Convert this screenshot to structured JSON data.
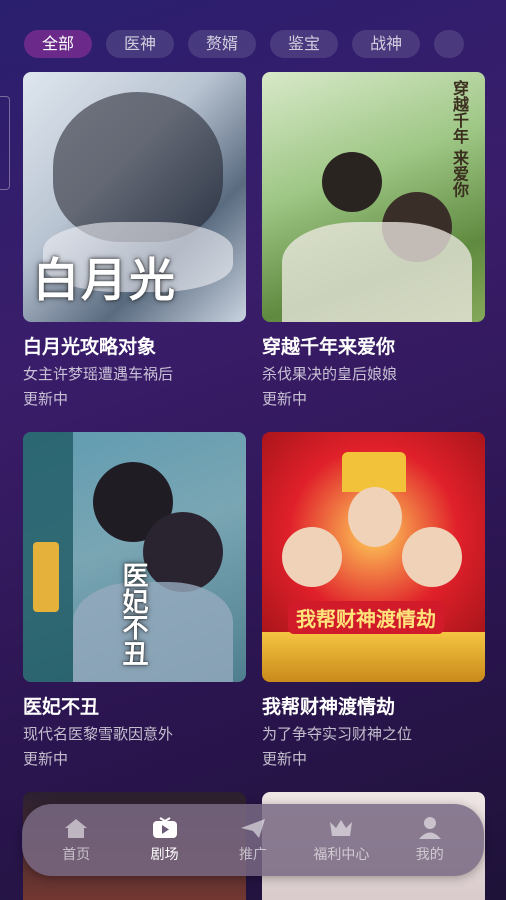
{
  "tabs": [
    "全部",
    "医神",
    "赘婿",
    "鉴宝",
    "战神",
    ""
  ],
  "cards": [
    {
      "title": "白月光攻略对象",
      "desc": "女主许梦瑶遭遇车祸后",
      "status": "更新中",
      "poster_text": "白月光"
    },
    {
      "title": "穿越千年来爱你",
      "desc": "杀伐果决的皇后娘娘",
      "status": "更新中",
      "poster_text": "穿越千年 来爱你"
    },
    {
      "title": "医妃不丑",
      "desc": "现代名医黎雪歌因意外",
      "status": "更新中",
      "poster_text": "医妃不丑"
    },
    {
      "title": "我帮财神渡情劫",
      "desc": "为了争夺实习财神之位",
      "status": "更新中",
      "poster_text": "我帮财神渡情劫"
    }
  ],
  "nav": {
    "items": [
      {
        "label": "首页",
        "icon": "home-icon",
        "active": false
      },
      {
        "label": "剧场",
        "icon": "tv-play-icon",
        "active": true
      },
      {
        "label": "推广",
        "icon": "paper-plane-icon",
        "active": false
      },
      {
        "label": "福利中心",
        "icon": "crown-icon",
        "active": false
      },
      {
        "label": "我的",
        "icon": "user-icon",
        "active": false
      }
    ]
  },
  "colors": {
    "accent": "#6b2a8a",
    "background": "#2b1550"
  }
}
